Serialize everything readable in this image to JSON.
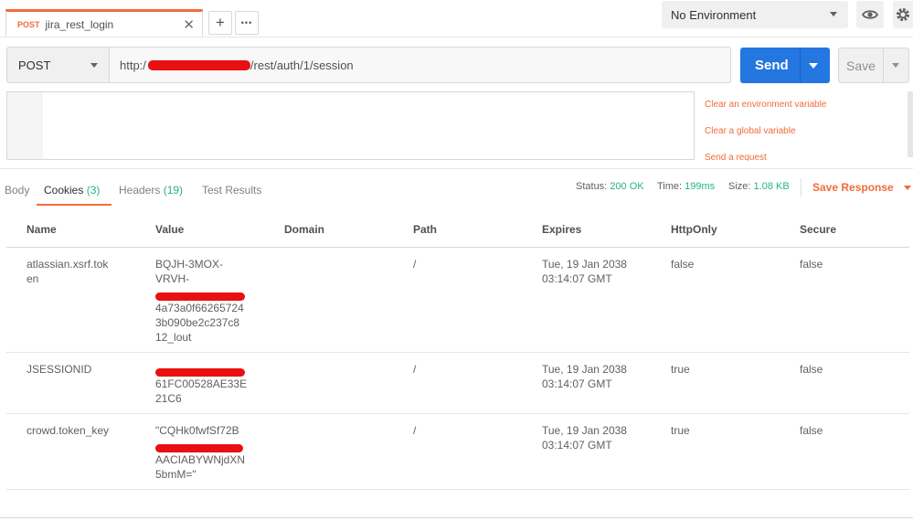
{
  "tab": {
    "method": "POST",
    "name": "jira_rest_login",
    "close": "✕"
  },
  "tab_actions": {
    "add": "+",
    "more": "•••"
  },
  "environment": {
    "selected": "No Environment"
  },
  "request": {
    "method": "POST",
    "url_prefix": "http:/",
    "url_suffix": "/rest/auth/1/session",
    "send_label": "Send",
    "save_label": "Save"
  },
  "snippets": [
    "Clear an environment variable",
    "Clear a global variable",
    "Send a request"
  ],
  "response_tabs": [
    {
      "label": "Body",
      "count": ""
    },
    {
      "label": "Cookies",
      "count": "(3)"
    },
    {
      "label": "Headers",
      "count": "(19)"
    },
    {
      "label": "Test Results",
      "count": ""
    }
  ],
  "response_meta": {
    "status_label": "Status:",
    "status": "200 OK",
    "time_label": "Time:",
    "time": "199ms",
    "size_label": "Size:",
    "size": "1.08 KB",
    "save_response": "Save Response"
  },
  "columns": [
    "Name",
    "Value",
    "Domain",
    "Path",
    "Expires",
    "HttpOnly",
    "Secure"
  ],
  "cookies": [
    {
      "name": [
        "atlassian.xsrf.tok",
        "en"
      ],
      "value_before": [
        "BQJH-3MOX-",
        "VRVH-"
      ],
      "value_after": [
        "4a73a0f66265724",
        "3b090be2c237c8",
        "12_lout"
      ],
      "domain": "",
      "path": "/",
      "expires": [
        "Tue, 19 Jan 2038",
        "03:14:07 GMT"
      ],
      "httponly": "false",
      "secure": "false"
    },
    {
      "name": [
        "JSESSIONID"
      ],
      "value_before": [],
      "value_after": [
        "61FC00528AE33E",
        "21C6"
      ],
      "domain": "",
      "path": "/",
      "expires": [
        "Tue, 19 Jan 2038",
        "03:14:07 GMT"
      ],
      "httponly": "true",
      "secure": "false"
    },
    {
      "name": [
        "crowd.token_key"
      ],
      "value_before": [
        "\"CQHk0fwfSf72B"
      ],
      "value_after": [
        "AACIABYWNjdXN",
        "5bmM=\""
      ],
      "domain": "",
      "path": "/",
      "expires": [
        "Tue, 19 Jan 2038",
        "03:14:07 GMT"
      ],
      "httponly": "true",
      "secure": "false"
    }
  ],
  "colors": {
    "accent": "#f26b3a",
    "send": "#2476e1",
    "success": "#26b47f",
    "redaction": "#e81010"
  }
}
